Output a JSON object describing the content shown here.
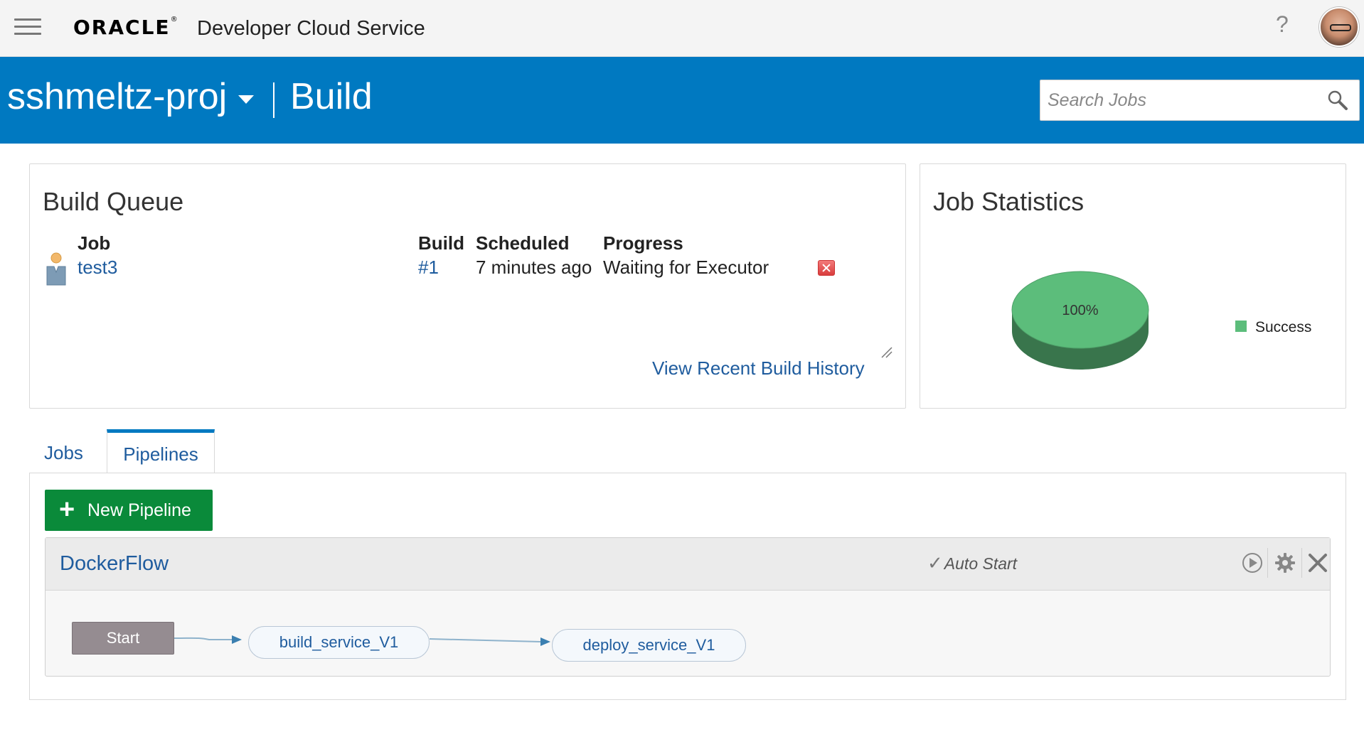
{
  "header": {
    "brand": "ORACLE",
    "product": "Developer Cloud Service",
    "help": "?"
  },
  "project": {
    "name": "sshmeltz-proj",
    "page": "Build",
    "search_placeholder": "Search Jobs"
  },
  "build_queue": {
    "title": "Build Queue",
    "columns": {
      "job": "Job",
      "build": "Build",
      "scheduled": "Scheduled",
      "progress": "Progress"
    },
    "rows": [
      {
        "job": "test3",
        "build": "#1",
        "scheduled": "7 minutes ago",
        "progress": "Waiting for Executor"
      }
    ],
    "history_link": "View Recent Build History"
  },
  "job_statistics": {
    "title": "Job Statistics",
    "chart_data": {
      "type": "pie",
      "categories": [
        "Success"
      ],
      "values": [
        100
      ],
      "labels": [
        "100%"
      ],
      "colors": [
        "#5cbd7b"
      ],
      "legend": "right"
    }
  },
  "tabs": [
    {
      "label": "Jobs",
      "active": false
    },
    {
      "label": "Pipelines",
      "active": true
    }
  ],
  "pipelines": {
    "new_button": "New Pipeline",
    "items": [
      {
        "name": "DockerFlow",
        "auto_start": "Auto Start",
        "stages": {
          "start": "Start",
          "build": "build_service_V1",
          "deploy": "deploy_service_V1"
        }
      }
    ]
  },
  "colors": {
    "brand_blue": "#0079c1",
    "link": "#1f5c9e",
    "new_button": "#0a8a3a",
    "success": "#5cbd7b"
  }
}
